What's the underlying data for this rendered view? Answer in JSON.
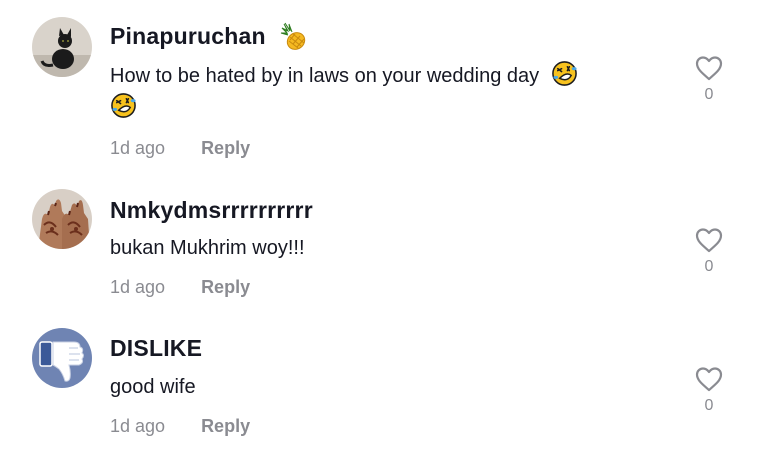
{
  "comments": [
    {
      "username": "Pinapuruchan",
      "username_badge": "pineapple-icon",
      "text": "How to be hated by in laws on your wedding day",
      "emojis": [
        "rolling-on-floor-laughing-emoji",
        "rolling-on-floor-laughing-emoji"
      ],
      "time": "1d ago",
      "reply_label": "Reply",
      "likes": "0",
      "avatar": "black-cat-avatar"
    },
    {
      "username": "Nmkydmsrrrrrrrrrr",
      "text": "bukan Mukhrim woy!!!",
      "time": "1d ago",
      "reply_label": "Reply",
      "likes": "0",
      "avatar": "henna-hands-avatar"
    },
    {
      "username": "DISLIKE",
      "text": "good wife",
      "time": "1d ago",
      "reply_label": "Reply",
      "likes": "0",
      "avatar": "thumbs-down-avatar"
    }
  ],
  "colors": {
    "text_primary": "#161823",
    "text_secondary": "#8a8b91",
    "emoji_yellow": "#f7c21e"
  }
}
